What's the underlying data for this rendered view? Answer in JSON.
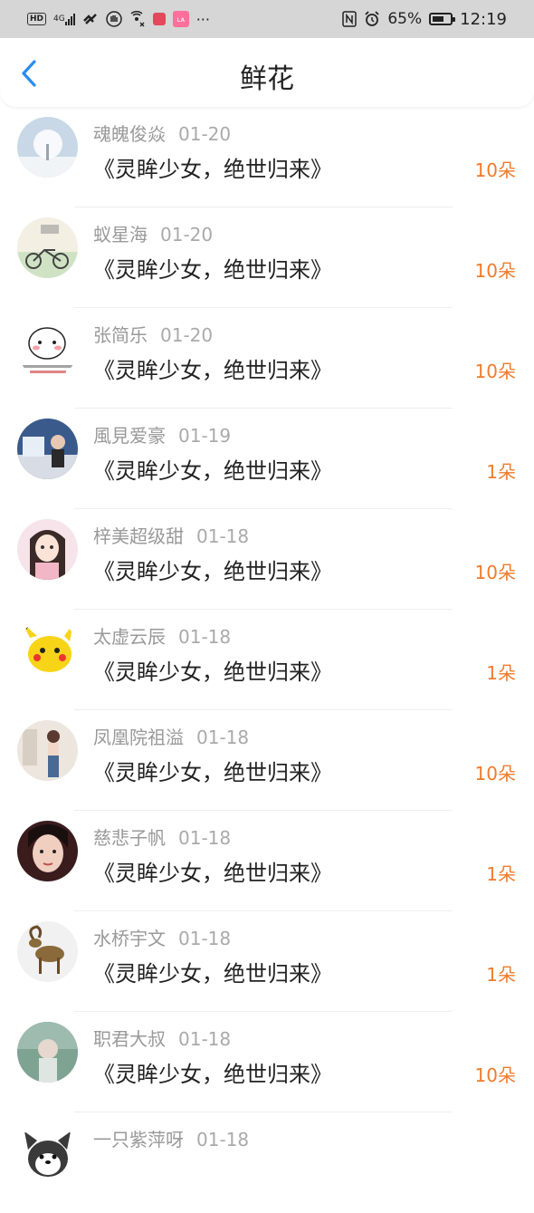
{
  "status_bar": {
    "hd": "HD",
    "network": "4G",
    "battery_percent": "65%",
    "battery_level": 0.65,
    "time": "12:19",
    "more": "···"
  },
  "header": {
    "title": "鲜花"
  },
  "items": [
    {
      "name": "魂魄俊焱",
      "date": "01-20",
      "book": "《灵眸少女，绝世归来》",
      "amount": "10朵"
    },
    {
      "name": "蚁星海",
      "date": "01-20",
      "book": "《灵眸少女，绝世归来》",
      "amount": "10朵"
    },
    {
      "name": "张简乐",
      "date": "01-20",
      "book": "《灵眸少女，绝世归来》",
      "amount": "10朵"
    },
    {
      "name": "風見爱豪",
      "date": "01-19",
      "book": "《灵眸少女，绝世归来》",
      "amount": "1朵"
    },
    {
      "name": "梓美超级甜",
      "date": "01-18",
      "book": "《灵眸少女，绝世归来》",
      "amount": "10朵"
    },
    {
      "name": "太虚云辰",
      "date": "01-18",
      "book": "《灵眸少女，绝世归来》",
      "amount": "1朵"
    },
    {
      "name": "凤凰院祖溢",
      "date": "01-18",
      "book": "《灵眸少女，绝世归来》",
      "amount": "10朵"
    },
    {
      "name": "慈悲子帆",
      "date": "01-18",
      "book": "《灵眸少女，绝世归来》",
      "amount": "1朵"
    },
    {
      "name": "水桥宇文",
      "date": "01-18",
      "book": "《灵眸少女，绝世归来》",
      "amount": "1朵"
    },
    {
      "name": "职君大叔",
      "date": "01-18",
      "book": "《灵眸少女，绝世归来》",
      "amount": "10朵"
    },
    {
      "name": "一只紫萍呀",
      "date": "01-18",
      "book": "",
      "amount": ""
    }
  ],
  "colors": {
    "accent": "#f07b2c",
    "back_arrow": "#2a8cf0"
  }
}
